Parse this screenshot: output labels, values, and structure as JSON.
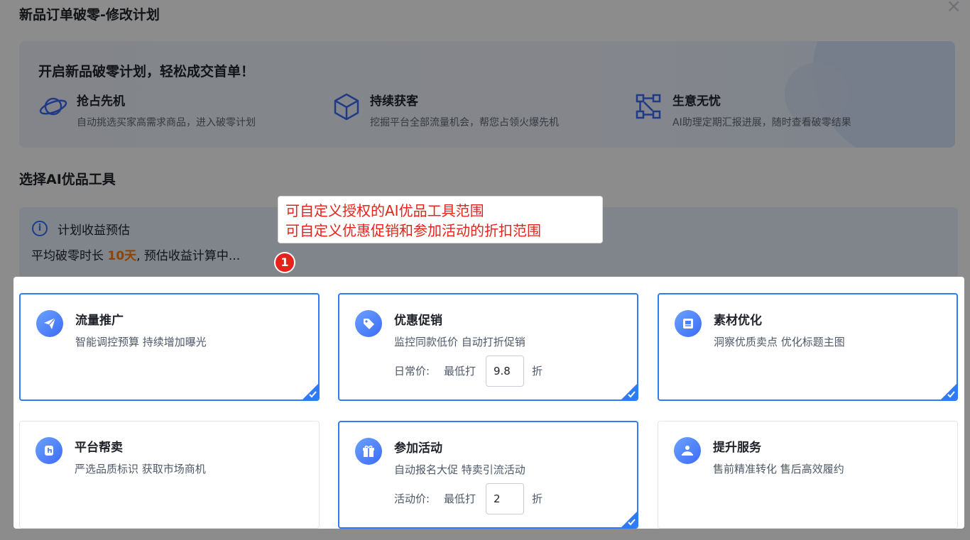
{
  "dialog": {
    "title": "新品订单破零-修改计划",
    "close_icon": "close-icon"
  },
  "banner": {
    "heading": "开启新品破零计划，轻松成交首单！",
    "features": [
      {
        "icon": "planet-icon",
        "title": "抢占先机",
        "desc": "自动挑选买家高需求商品，进入破零计划"
      },
      {
        "icon": "cube-icon",
        "title": "持续获客",
        "desc": "挖掘平台全部流量机会，帮您占领火爆先机"
      },
      {
        "icon": "flow-icon",
        "title": "生意无忧",
        "desc": "AI助理定期汇报进展，随时查看破零结果"
      }
    ]
  },
  "section_title": "选择AI优品工具",
  "estimate": {
    "title": "计划收益预估",
    "prefix": "平均破零时长 ",
    "days": "10天",
    "suffix": ", 预估收益计算中..."
  },
  "annotation": {
    "lines": [
      "可自定义授权的AI优品工具范围",
      "可自定义优惠促销和参加活动的折扣范围"
    ],
    "badge": "1"
  },
  "tools": [
    {
      "title": "流量推广",
      "desc": "智能调控预算 持续增加曝光",
      "selected": true,
      "icon": "paper-plane-icon"
    },
    {
      "title": "优惠促销",
      "desc": "监控同款低价 自动打折促销",
      "selected": true,
      "icon": "price-tag-icon",
      "price_label": "日常价:",
      "min_label": "最低打",
      "value": "9.8",
      "unit": "折"
    },
    {
      "title": "素材优化",
      "desc": "洞察优质卖点 优化标题主图",
      "selected": true,
      "icon": "image-icon"
    },
    {
      "title": "平台帮卖",
      "desc": "严选品质标识 获取市场商机",
      "selected": false,
      "icon": "hand-tap-icon"
    },
    {
      "title": "参加活动",
      "desc": "自动报名大促 特卖引流活动",
      "selected": true,
      "icon": "gift-icon",
      "price_label": "活动价:",
      "min_label": "最低打",
      "value": "2",
      "unit": "折"
    },
    {
      "title": "提升服务",
      "desc": "售前精准转化 售后高效履约",
      "selected": false,
      "icon": "service-bell-icon"
    }
  ],
  "colors": {
    "accent": "#2f7bf5",
    "highlight": "#ff7d00",
    "annotation": "#e5231b"
  }
}
